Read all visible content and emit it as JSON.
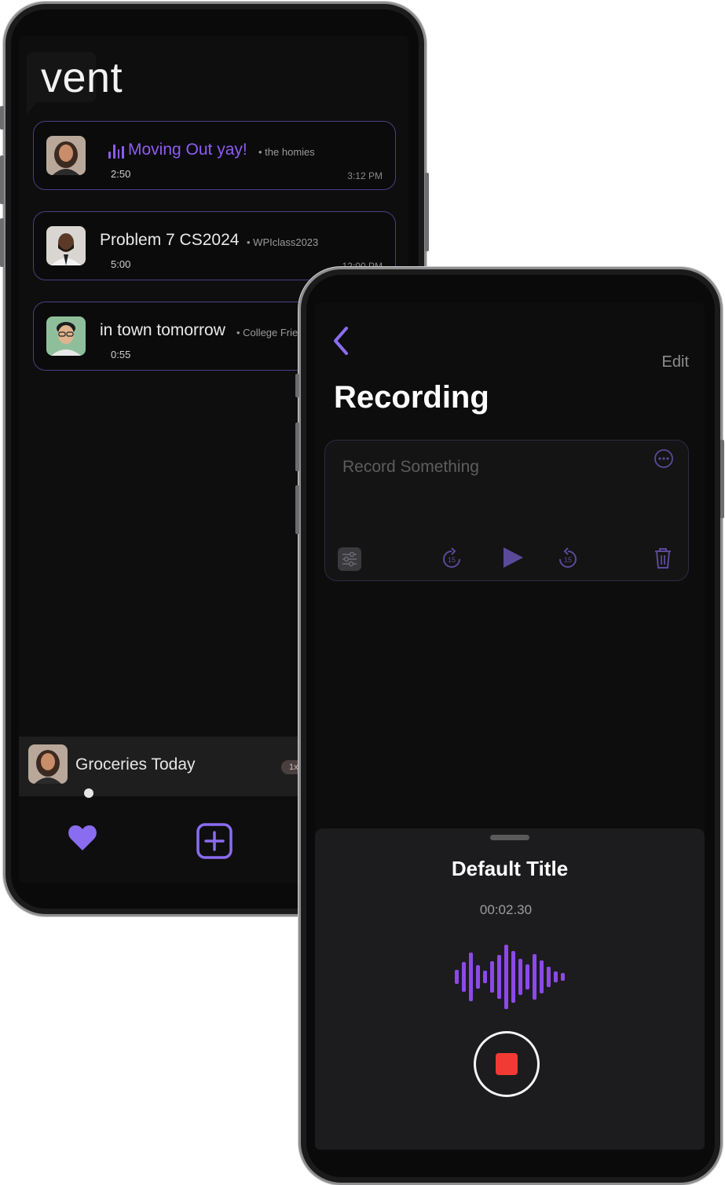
{
  "list_screen": {
    "app_title": "vent",
    "recordings": [
      {
        "title": "Moving Out yay!",
        "group": "the homies",
        "duration": "2:50",
        "time": "3:12 PM",
        "playing": true
      },
      {
        "title": "Problem 7 CS2024",
        "group": "WPIclass2023",
        "duration": "5:00",
        "time": "12:00 PM",
        "playing": false
      },
      {
        "title": "in town tomorrow",
        "group": "College Frie",
        "duration": "0:55",
        "time": "",
        "playing": false
      }
    ],
    "mini_player": {
      "title": "Groceries Today",
      "speed": "1x",
      "progress": 0.22
    },
    "tab_bar": {
      "icons": [
        "heart-icon",
        "add-square-icon"
      ]
    }
  },
  "recording_screen": {
    "edit_label": "Edit",
    "title": "Recording",
    "placeholder": "Record Something",
    "controls": [
      "settings-sliders-icon",
      "rewind-15-icon",
      "play-icon",
      "forward-15-icon",
      "trash-icon"
    ],
    "skip_seconds": "15",
    "sheet": {
      "title": "Default Title",
      "elapsed": "00:02.30"
    }
  },
  "colors": {
    "accent": "#8d5cf0",
    "card_border": "#4b3f83",
    "record_red": "#f13a33",
    "background": "#0d0d0d"
  }
}
